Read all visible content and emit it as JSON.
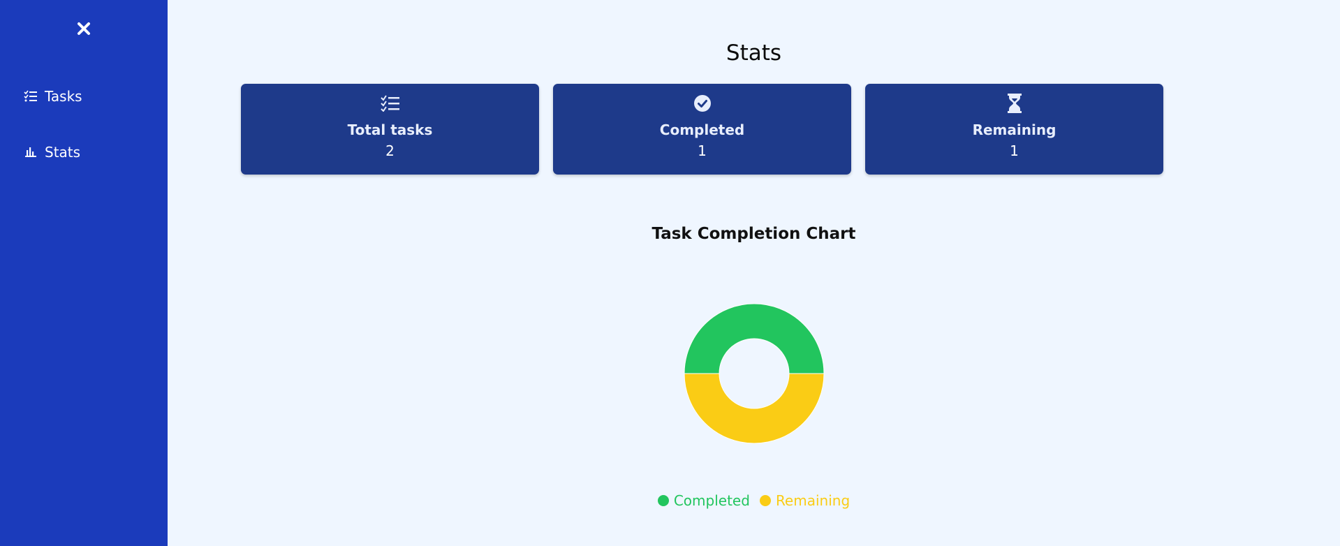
{
  "sidebar": {
    "close_icon": "close-icon",
    "items": [
      {
        "label": "Tasks",
        "icon": "task-list-icon"
      },
      {
        "label": "Stats",
        "icon": "bar-chart-icon"
      }
    ]
  },
  "main": {
    "title": "Stats",
    "cards": [
      {
        "label": "Total tasks",
        "value": "2",
        "icon": "task-list-icon"
      },
      {
        "label": "Completed",
        "value": "1",
        "icon": "check-circle-icon"
      },
      {
        "label": "Remaining",
        "value": "1",
        "icon": "hourglass-icon"
      }
    ],
    "chart_title": "Task Completion Chart"
  },
  "colors": {
    "sidebar": "#1b3bbb",
    "card": "#1e3a8a",
    "background": "#eff6ff",
    "completed": "#22c55e",
    "remaining": "#facc15"
  },
  "chart_data": {
    "type": "pie",
    "title": "Task Completion Chart",
    "donut": true,
    "categories": [
      "Completed",
      "Remaining"
    ],
    "values": [
      1,
      1
    ],
    "colors": [
      "#22c55e",
      "#facc15"
    ],
    "legend": "bottom"
  }
}
